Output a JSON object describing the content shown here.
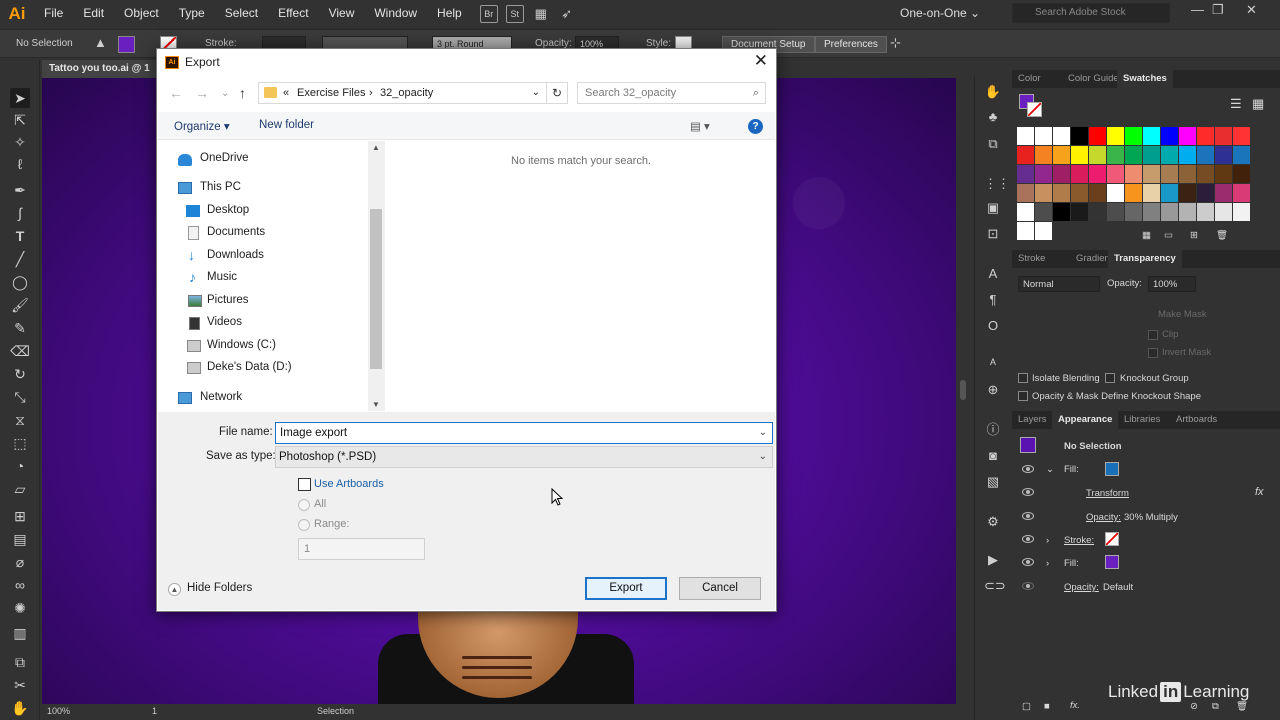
{
  "app": {
    "logo": "Ai",
    "menu": [
      "File",
      "Edit",
      "Object",
      "Type",
      "Select",
      "Effect",
      "View",
      "Window",
      "Help"
    ],
    "bridge_label": "Br",
    "stock_label": "St",
    "workspace": "One-on-One",
    "stock_search_placeholder": "Search Adobe Stock"
  },
  "controlbar": {
    "selection": "No Selection",
    "stroke_label": "Stroke:",
    "brush": "3 pt. Round",
    "opacity_label": "Opacity:",
    "opacity_value": "100%",
    "style_label": "Style:",
    "doc_setup": "Document Setup",
    "preferences": "Preferences"
  },
  "document": {
    "tab_title": "Tattoo you too.ai @ 1"
  },
  "statusbar": {
    "zoom": "100%",
    "artboard": "1",
    "status": "Selection"
  },
  "swatches_panel": {
    "tabs": [
      "Color",
      "Color Guide",
      "Swatches"
    ],
    "active_tab": "Swatches",
    "colors": [
      "#ffffff",
      "#ffffff",
      "#ffffff",
      "#000000",
      "#ff0000",
      "#ffff00",
      "#00ff00",
      "#00ffff",
      "#0000ff",
      "#ff00ff",
      "#ff2b2b",
      "#e82e2e",
      "#ff3333",
      "#e8231f",
      "#f58220",
      "#f7a21b",
      "#fff200",
      "#c5d92d",
      "#39b54a",
      "#00a651",
      "#009e8f",
      "#00aaad",
      "#00aeef",
      "#1c75bc",
      "#2e3192",
      "#1b75bb",
      "#662d91",
      "#92278f",
      "#9e1f63",
      "#d91c5c",
      "#ed1c6e",
      "#f05a78",
      "#ed8c6e",
      "#c69c6d",
      "#a67c52",
      "#8c6239",
      "#754c24",
      "#603913",
      "#42210b",
      "#a8725b",
      "#c6905f",
      "#b07d4a",
      "#8b5a2b",
      "#6b3e1c",
      "#ffffff",
      "#f7941d",
      "#e8d1a8",
      "#1899c8",
      "#3b2314",
      "#2a1e3a",
      "#9b2d6f",
      "#d83b75",
      "#ffffff",
      "#4d4d4d",
      "#000000",
      "#1a1a1a",
      "#333333",
      "#4d4d4d",
      "#666666",
      "#808080",
      "#999999",
      "#b3b3b3",
      "#cccccc",
      "#e6e6e6",
      "#f2f2f2",
      "#ffffff",
      "#ffffff"
    ]
  },
  "transparency_panel": {
    "tabs": [
      "Stroke",
      "Gradient",
      "Transparency"
    ],
    "active_tab": "Transparency",
    "blend_mode": "Normal",
    "opacity_label": "Opacity:",
    "opacity_value": "100%",
    "make_mask": "Make Mask",
    "clip": "Clip",
    "invert_mask": "Invert Mask",
    "isolate_blending": "Isolate Blending",
    "knockout_group": "Knockout Group",
    "opacity_mask_define": "Opacity & Mask Define Knockout Shape"
  },
  "appearance_panel": {
    "tabs": [
      "Layers",
      "Appearance",
      "Libraries",
      "Artboards"
    ],
    "active_tab": "Appearance",
    "header": "No Selection",
    "rows": [
      {
        "label": "Fill:"
      },
      {
        "label": "Transform",
        "fx": "fx"
      },
      {
        "label": "Opacity:",
        "value": "30% Multiply"
      },
      {
        "label": "Stroke:"
      },
      {
        "label": "Fill:"
      },
      {
        "label": "Opacity:",
        "value": "Default"
      }
    ]
  },
  "export_dialog": {
    "title": "Export",
    "breadcrumb": [
      "«",
      "Exercise Files",
      "32_opacity"
    ],
    "search_placeholder": "Search 32_opacity",
    "organize": "Organize ▾",
    "new_folder": "New folder",
    "help": "?",
    "nav_items": [
      "OneDrive",
      "This PC",
      "Desktop",
      "Documents",
      "Downloads",
      "Music",
      "Pictures",
      "Videos",
      "Windows (C:)",
      "Deke's Data (D:)",
      "Network"
    ],
    "empty_message": "No items match your search.",
    "file_name_label": "File name:",
    "file_name_value": "Image export",
    "save_as_type_label": "Save as type:",
    "save_as_type_value": "Photoshop (*.PSD)",
    "use_artboards": "Use Artboards",
    "all": "All",
    "range": "Range:",
    "range_value": "1",
    "hide_folders": "Hide Folders",
    "export_button": "Export",
    "cancel_button": "Cancel"
  },
  "watermark": {
    "left": "Linked",
    "box": "in",
    "right": "Learning"
  }
}
